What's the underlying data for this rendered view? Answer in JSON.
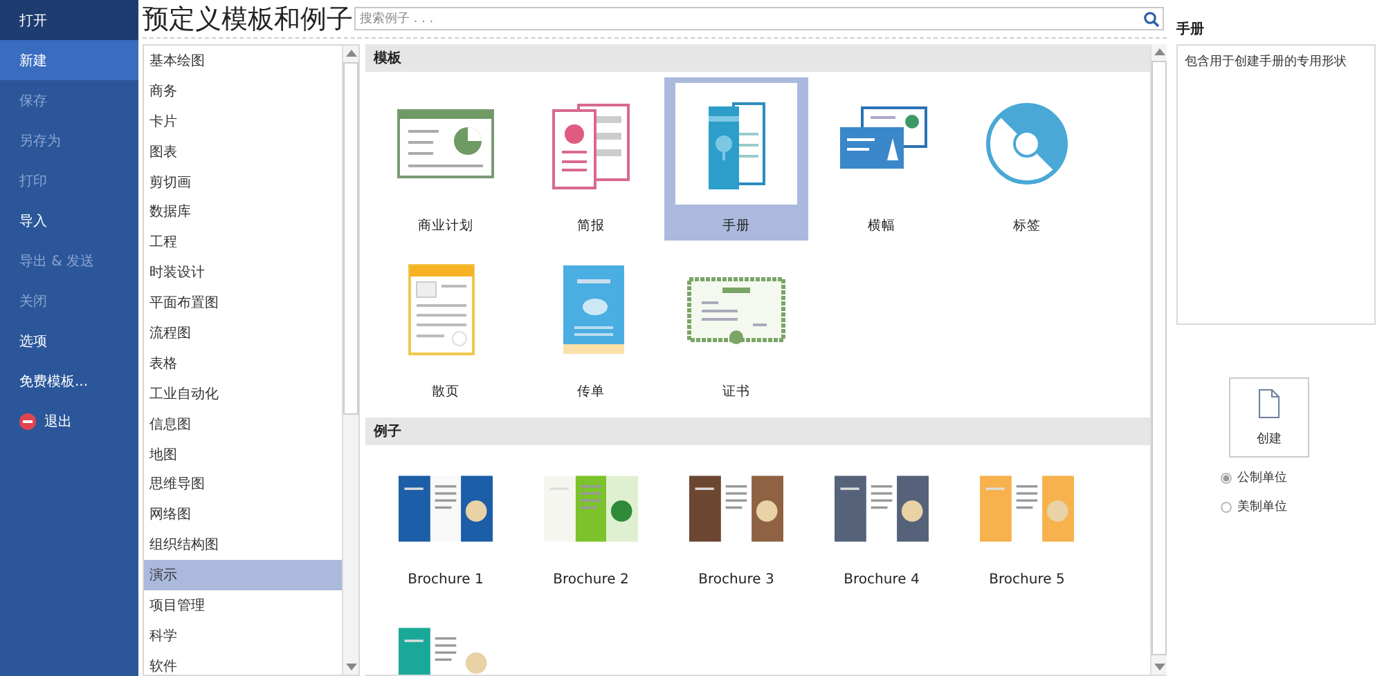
{
  "sidebar": {
    "items": [
      {
        "label": "打开",
        "hovered": true,
        "selected": false,
        "disabled": false
      },
      {
        "label": "新建",
        "hovered": false,
        "selected": true,
        "disabled": false
      },
      {
        "label": "保存",
        "hovered": false,
        "selected": false,
        "disabled": true
      },
      {
        "label": "另存为",
        "hovered": false,
        "selected": false,
        "disabled": true
      },
      {
        "label": "打印",
        "hovered": false,
        "selected": false,
        "disabled": true
      },
      {
        "label": "导入",
        "hovered": false,
        "selected": false,
        "disabled": false
      },
      {
        "label": "导出 & 发送",
        "hovered": false,
        "selected": false,
        "disabled": true
      },
      {
        "label": "关闭",
        "hovered": false,
        "selected": false,
        "disabled": true
      },
      {
        "label": "选项",
        "hovered": false,
        "selected": false,
        "disabled": false
      },
      {
        "label": "免费模板...",
        "hovered": false,
        "selected": false,
        "disabled": false
      },
      {
        "label": "退出",
        "hovered": false,
        "selected": false,
        "disabled": false,
        "kind": "exit"
      }
    ]
  },
  "title": "预定义模板和例子",
  "search": {
    "placeholder": "搜索例子 . . ."
  },
  "categories": [
    {
      "label": "基本绘图",
      "selected": false
    },
    {
      "label": "商务",
      "selected": false
    },
    {
      "label": "卡片",
      "selected": false
    },
    {
      "label": "图表",
      "selected": false
    },
    {
      "label": "剪切画",
      "selected": false
    },
    {
      "label": "数据库",
      "selected": false
    },
    {
      "label": "工程",
      "selected": false
    },
    {
      "label": "时装设计",
      "selected": false
    },
    {
      "label": "平面布置图",
      "selected": false
    },
    {
      "label": "流程图",
      "selected": false
    },
    {
      "label": "表格",
      "selected": false
    },
    {
      "label": "工业自动化",
      "selected": false
    },
    {
      "label": "信息图",
      "selected": false
    },
    {
      "label": "地图",
      "selected": false
    },
    {
      "label": "思维导图",
      "selected": false
    },
    {
      "label": "网络图",
      "selected": false
    },
    {
      "label": "组织结构图",
      "selected": false
    },
    {
      "label": "演示",
      "selected": true
    },
    {
      "label": "项目管理",
      "selected": false
    },
    {
      "label": "科学",
      "selected": false
    },
    {
      "label": "软件",
      "selected": false
    }
  ],
  "templates": {
    "heading": "模板",
    "items": [
      {
        "label": "商业计划",
        "selected": false
      },
      {
        "label": "简报",
        "selected": false
      },
      {
        "label": "手册",
        "selected": true
      },
      {
        "label": "横幅",
        "selected": false
      },
      {
        "label": "标签",
        "selected": false
      },
      {
        "label": "散页",
        "selected": false
      },
      {
        "label": "传单",
        "selected": false
      },
      {
        "label": "证书",
        "selected": false
      }
    ]
  },
  "examples": {
    "heading": "例子",
    "items": [
      {
        "label": "Brochure 1",
        "selected": false
      },
      {
        "label": "Brochure 2",
        "selected": false
      },
      {
        "label": "Brochure 3",
        "selected": false
      },
      {
        "label": "Brochure 4",
        "selected": false
      },
      {
        "label": "Brochure 5",
        "selected": false
      },
      {
        "selected": false
      }
    ]
  },
  "details": {
    "title": "手册",
    "description": "包含用于创建手册的专用形状",
    "create_button": "创建",
    "units": [
      {
        "label": "公制单位",
        "selected": true
      },
      {
        "label": "美制单位",
        "selected": false
      }
    ]
  }
}
